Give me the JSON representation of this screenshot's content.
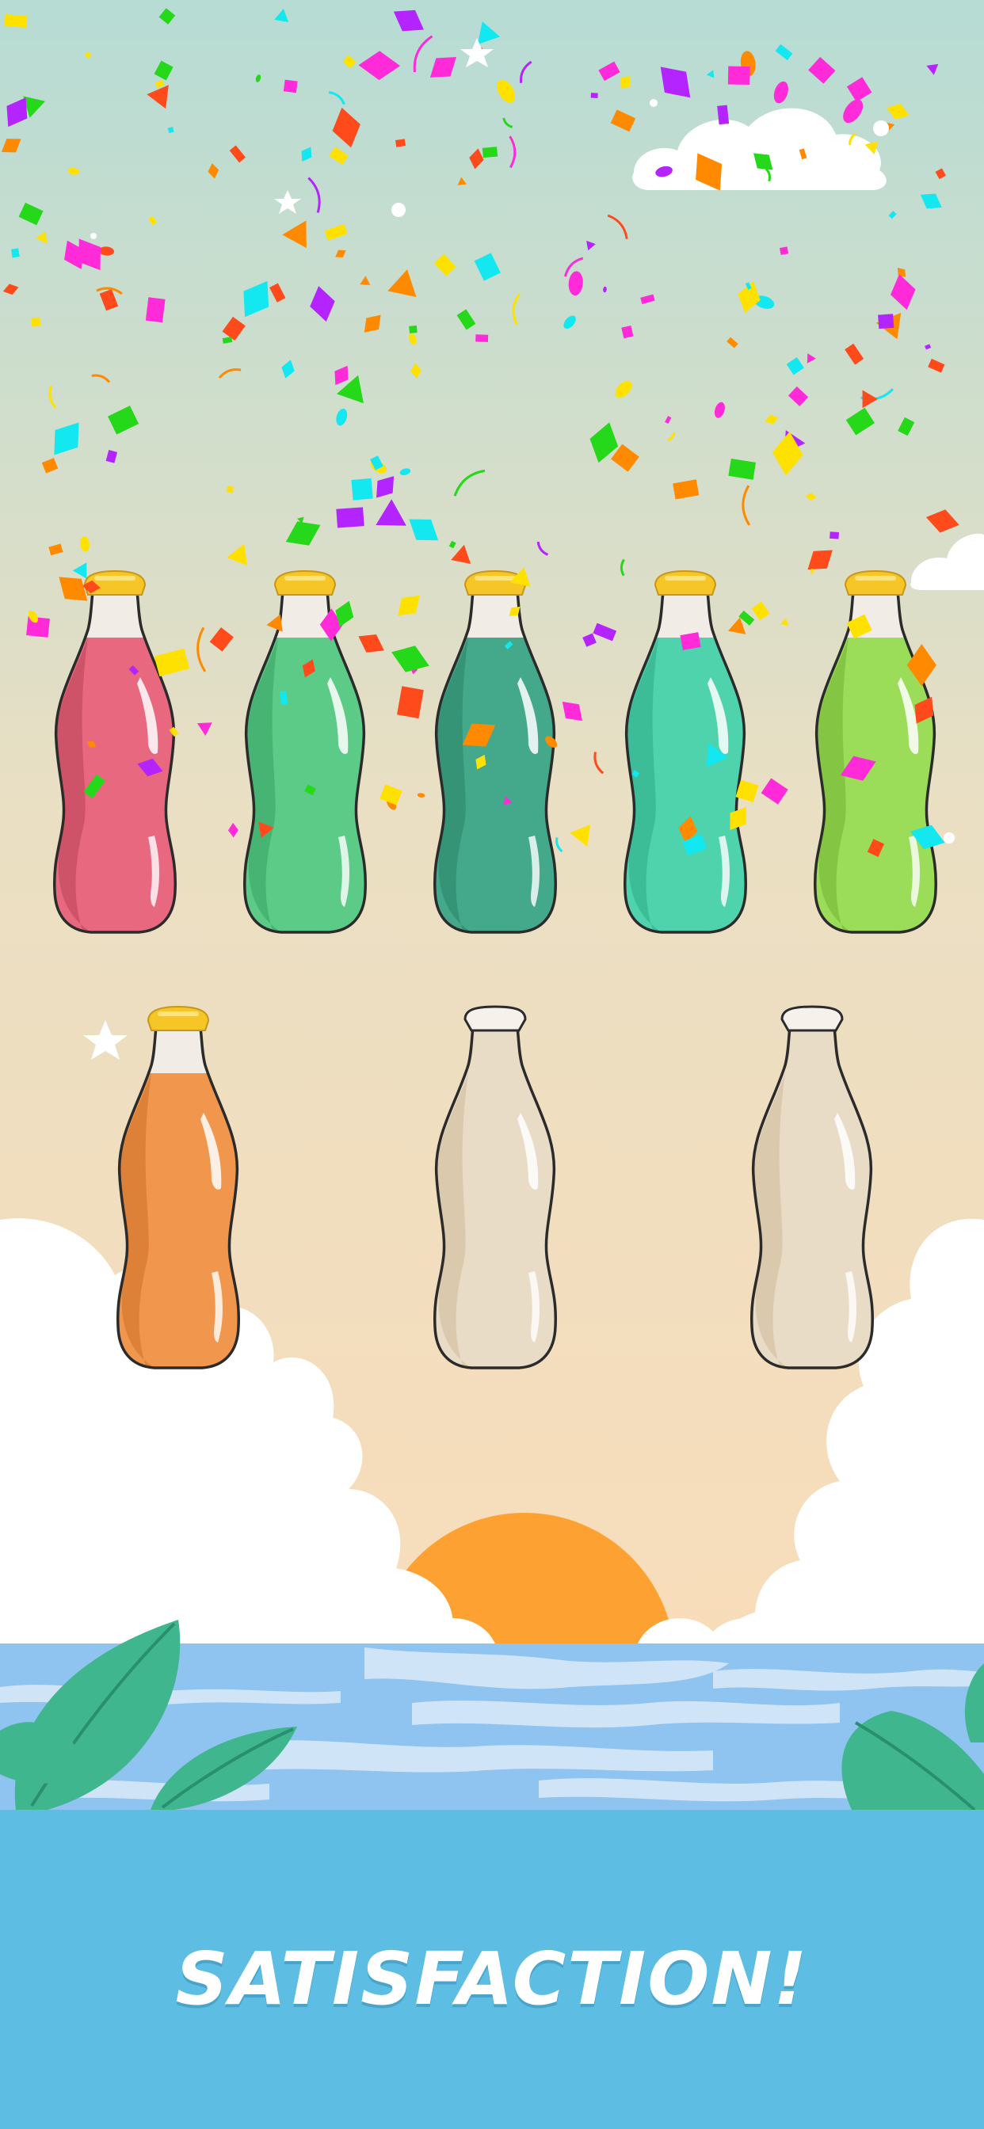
{
  "caption": {
    "text": "SATISFACTION!"
  },
  "colors": {
    "sky_top": "#b6dcd4",
    "sky_mid": "#eadfc3",
    "sky_bottom": "#fbdcb8",
    "sun": "#fda132",
    "cloud": "#ffffff",
    "sea_light": "#cfe4f7",
    "sea_blue": "#8fc3f0",
    "leaf": "#3fb68e",
    "leaf_dark": "#2a8f6e",
    "caption_panel": "#5dbde2",
    "cap_gold": "#f6c526",
    "outline": "#2b2b2b"
  },
  "bottles": [
    {
      "name": "bottle-pink",
      "color": "#e8697f",
      "shade": "#c95064",
      "filled": true
    },
    {
      "name": "bottle-green",
      "color": "#5ccb88",
      "shade": "#44b070",
      "filled": true
    },
    {
      "name": "bottle-teal",
      "color": "#44a98a",
      "shade": "#338f72",
      "filled": true
    },
    {
      "name": "bottle-mint",
      "color": "#4fd3ad",
      "shade": "#38b994",
      "filled": true
    },
    {
      "name": "bottle-lime",
      "color": "#9bdc58",
      "shade": "#80c23f",
      "filled": true
    },
    {
      "name": "bottle-orange",
      "color": "#f0964d",
      "shade": "#d97d35",
      "filled": true
    },
    {
      "name": "bottle-empty-1",
      "color": "#e9dcc7",
      "shade": "#d8c6a9",
      "filled": false
    },
    {
      "name": "bottle-empty-2",
      "color": "#e9dcc7",
      "shade": "#d8c6a9",
      "filled": false
    }
  ],
  "confetti_colors": [
    "#ff2ad8",
    "#ffe100",
    "#ff4a1c",
    "#13e7f0",
    "#26d81a",
    "#b424ff",
    "#ff8a00"
  ]
}
